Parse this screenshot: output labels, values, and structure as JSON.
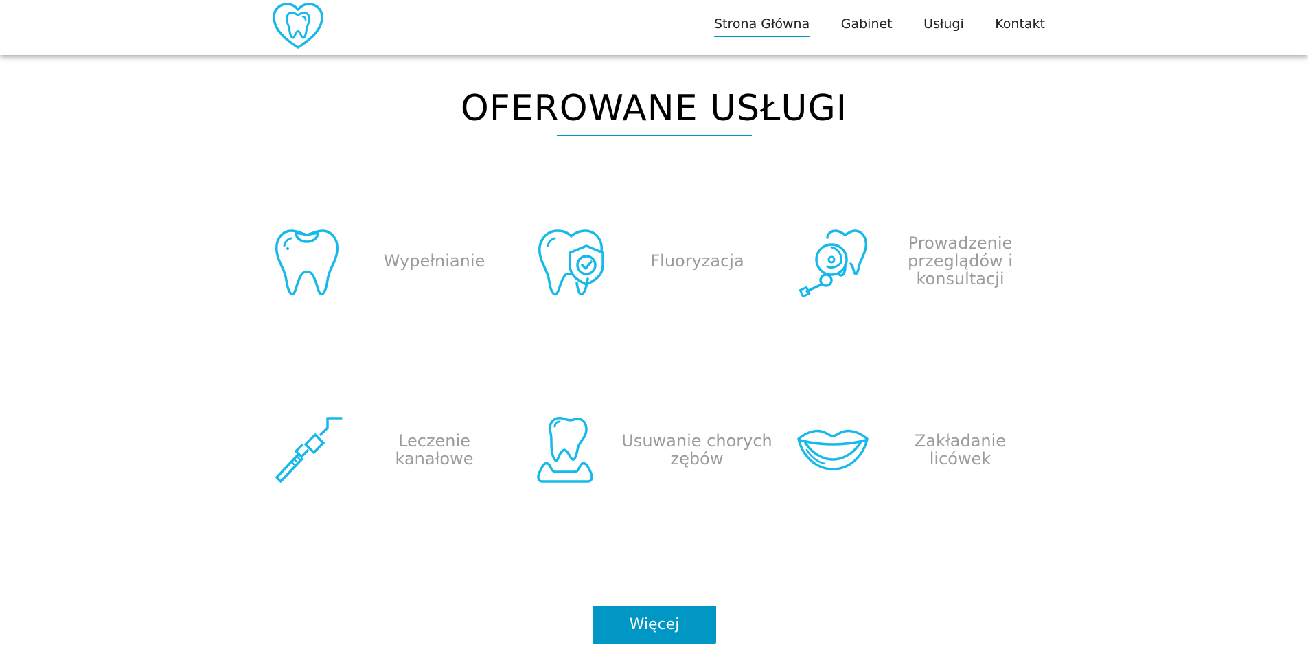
{
  "brand": {
    "logo_icon": "heart-tooth-icon",
    "accent_color": "#0097c5",
    "icon_color": "#17b9ea"
  },
  "nav": {
    "items": [
      {
        "label": "Strona Główna",
        "active": true
      },
      {
        "label": "Gabinet",
        "active": false
      },
      {
        "label": "Usługi",
        "active": false
      },
      {
        "label": "Kontakt",
        "active": false
      }
    ]
  },
  "main": {
    "title": "OFEROWANE USŁUGI",
    "services": [
      {
        "icon": "tooth-filling-icon",
        "label": "Wypełnianie"
      },
      {
        "icon": "tooth-shield-icon",
        "label": "Fluoryzacja"
      },
      {
        "icon": "dental-mirror-icon",
        "label": "Prowadzenie przeglądów i konsultacji"
      },
      {
        "icon": "dental-probe-icon",
        "label": "Leczenie kanałowe"
      },
      {
        "icon": "tooth-extraction-icon",
        "label": "Usuwanie chorych zębów"
      },
      {
        "icon": "smile-lips-icon",
        "label": "Zakładanie licówek"
      }
    ],
    "more_button": "Więcej"
  }
}
